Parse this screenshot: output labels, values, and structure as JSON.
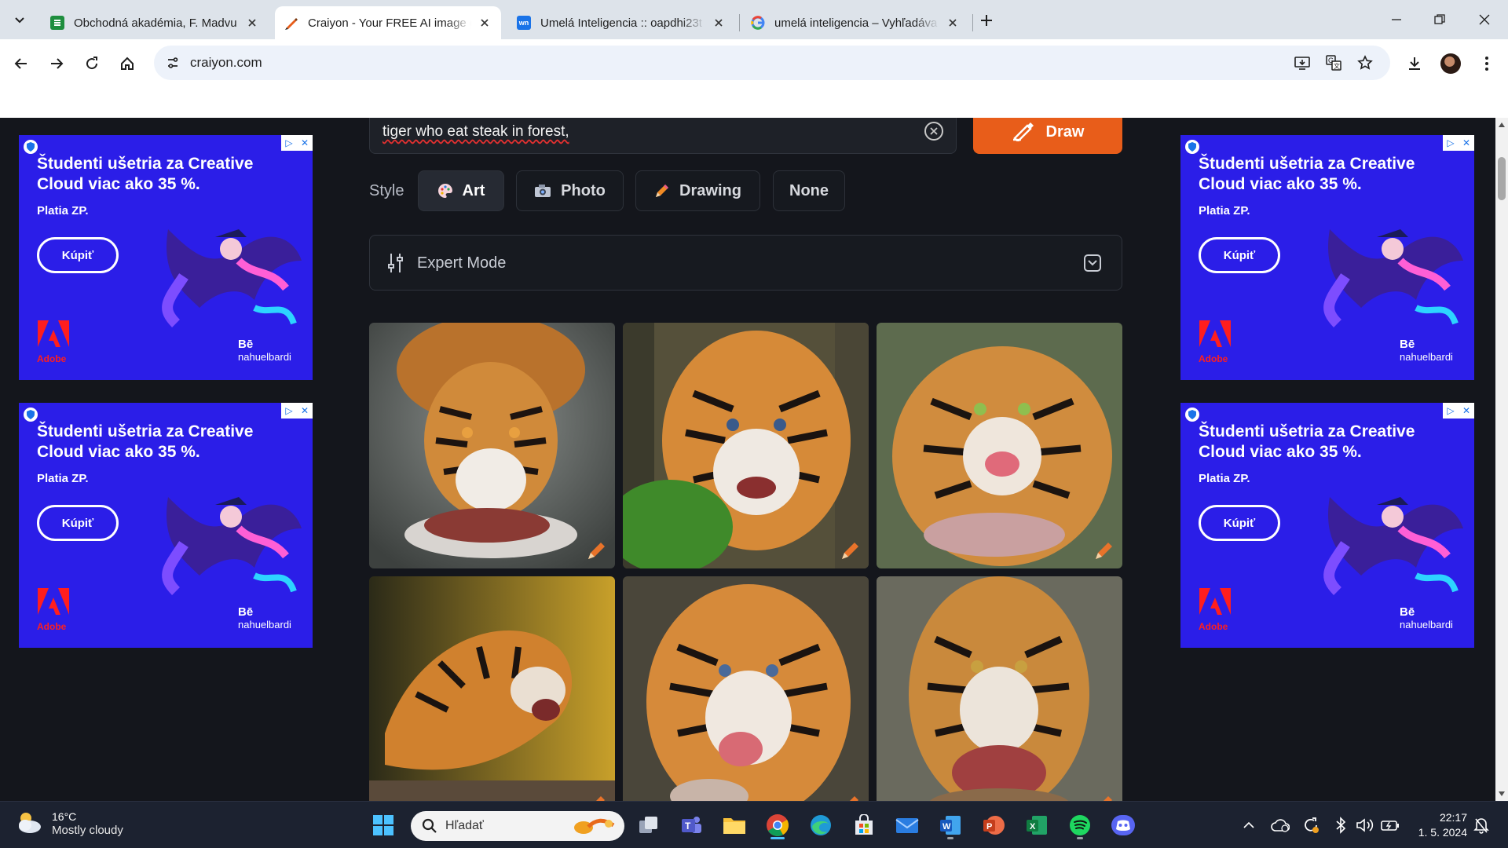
{
  "browser": {
    "tabs": [
      {
        "title": "Obchodná akadémia, F. Madvu",
        "favicon": "classroom-icon",
        "active": false
      },
      {
        "title": "Craiyon - Your FREE AI image g",
        "favicon": "craiyon-icon",
        "active": true
      },
      {
        "title": "Umelá Inteligencia :: oapdhi23t",
        "favicon": "wn-icon",
        "active": false
      },
      {
        "title": "umelá inteligencia – Vyhľadáva",
        "favicon": "google-icon",
        "active": false
      }
    ],
    "url": "craiyon.com"
  },
  "craiyon": {
    "prompt": "tiger who eat steak in forest,",
    "draw_label": "Draw",
    "style_label": "Style",
    "styles": [
      {
        "label": "Art",
        "icon": "palette-icon",
        "active": true
      },
      {
        "label": "Photo",
        "icon": "camera-icon",
        "active": false
      },
      {
        "label": "Drawing",
        "icon": "pencil-icon",
        "active": false
      },
      {
        "label": "None",
        "icon": "",
        "active": false
      }
    ],
    "expert_mode_label": "Expert Mode",
    "images": [
      {
        "name": "tiger-image-1"
      },
      {
        "name": "tiger-image-2"
      },
      {
        "name": "tiger-image-3"
      },
      {
        "name": "tiger-image-4"
      },
      {
        "name": "tiger-image-5"
      },
      {
        "name": "tiger-image-6"
      }
    ]
  },
  "ad": {
    "headline": "Študenti ušetria za Creative Cloud viac ako 35 %.",
    "sub": "Platia ZP.",
    "button": "Kúpiť",
    "brand": "Adobe",
    "be_label": "Bē",
    "artist": "nahuelbardi"
  },
  "taskbar": {
    "temperature": "16°C",
    "weather": "Mostly cloudy",
    "search_placeholder": "Hľadať",
    "time": "22:17",
    "date": "1. 5. 2024"
  },
  "colors": {
    "draw_button": "#e85d1a",
    "ad_background": "#2b1ee8",
    "page_background": "#14161c"
  }
}
